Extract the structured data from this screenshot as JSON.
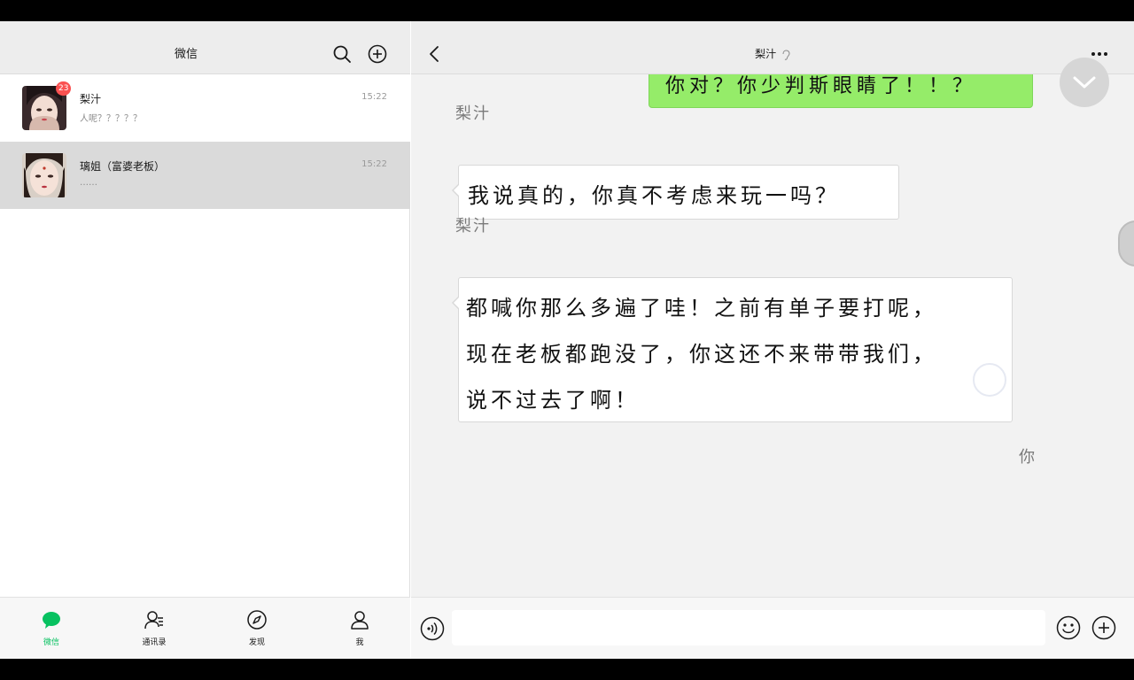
{
  "sidebar": {
    "title": "微信",
    "chats": [
      {
        "name": "梨汁",
        "time": "15:22",
        "preview": "人呢？？？？？",
        "unread": "23",
        "icon": "avatar-woman-icon"
      },
      {
        "name": "璃姐（富婆老板）",
        "time": "15:22",
        "preview": "……",
        "icon": "avatar-woman-icon"
      }
    ],
    "tabs": [
      {
        "label": "微信",
        "icon": "chat-bubble-icon"
      },
      {
        "label": "通讯录",
        "icon": "contacts-icon"
      },
      {
        "label": "发现",
        "icon": "compass-icon"
      },
      {
        "label": "我",
        "icon": "person-icon"
      }
    ]
  },
  "conversation": {
    "title": "梨汁",
    "messages": [
      {
        "from": "梨汁",
        "text": "我说真的，你真不考虑来玩一吗？"
      },
      {
        "from": "梨汁",
        "lines": [
          "都喊你那么多遍了哇！之前有单子要打呢，",
          "现在老板都跑没了，你这还不来带带我们，",
          "说不过去了啊！"
        ]
      }
    ],
    "outgoing_partial": "你对？你少判斯眼睛了！！？",
    "you_label": "你",
    "input": {
      "value": "",
      "placeholder": ""
    }
  },
  "colors": {
    "accent": "#07c160",
    "outgoing_bubble": "#95ec69",
    "badge": "#fa5151",
    "header_bg": "#ededed",
    "active_row": "#dadada"
  }
}
